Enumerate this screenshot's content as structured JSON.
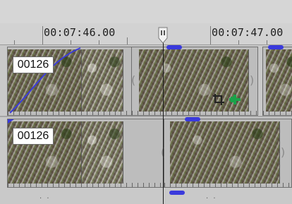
{
  "timeline": {
    "timecode_left": "00:07:46.00",
    "timecode_right": "00:07:47.00"
  },
  "tracks": [
    {
      "clip_counter": "00126",
      "bracket_left": "(",
      "bracket_right": ")"
    },
    {
      "clip_counter": "00126",
      "bracket_left": "(",
      "bracket_right": ")"
    }
  ],
  "clip_tools": {
    "crop_icon": "crop-icon",
    "pan_icon": "event-pan-crop-icon"
  },
  "colors": {
    "fade_curve": "#3a3adc",
    "pan_icon": "#1aa34a"
  }
}
